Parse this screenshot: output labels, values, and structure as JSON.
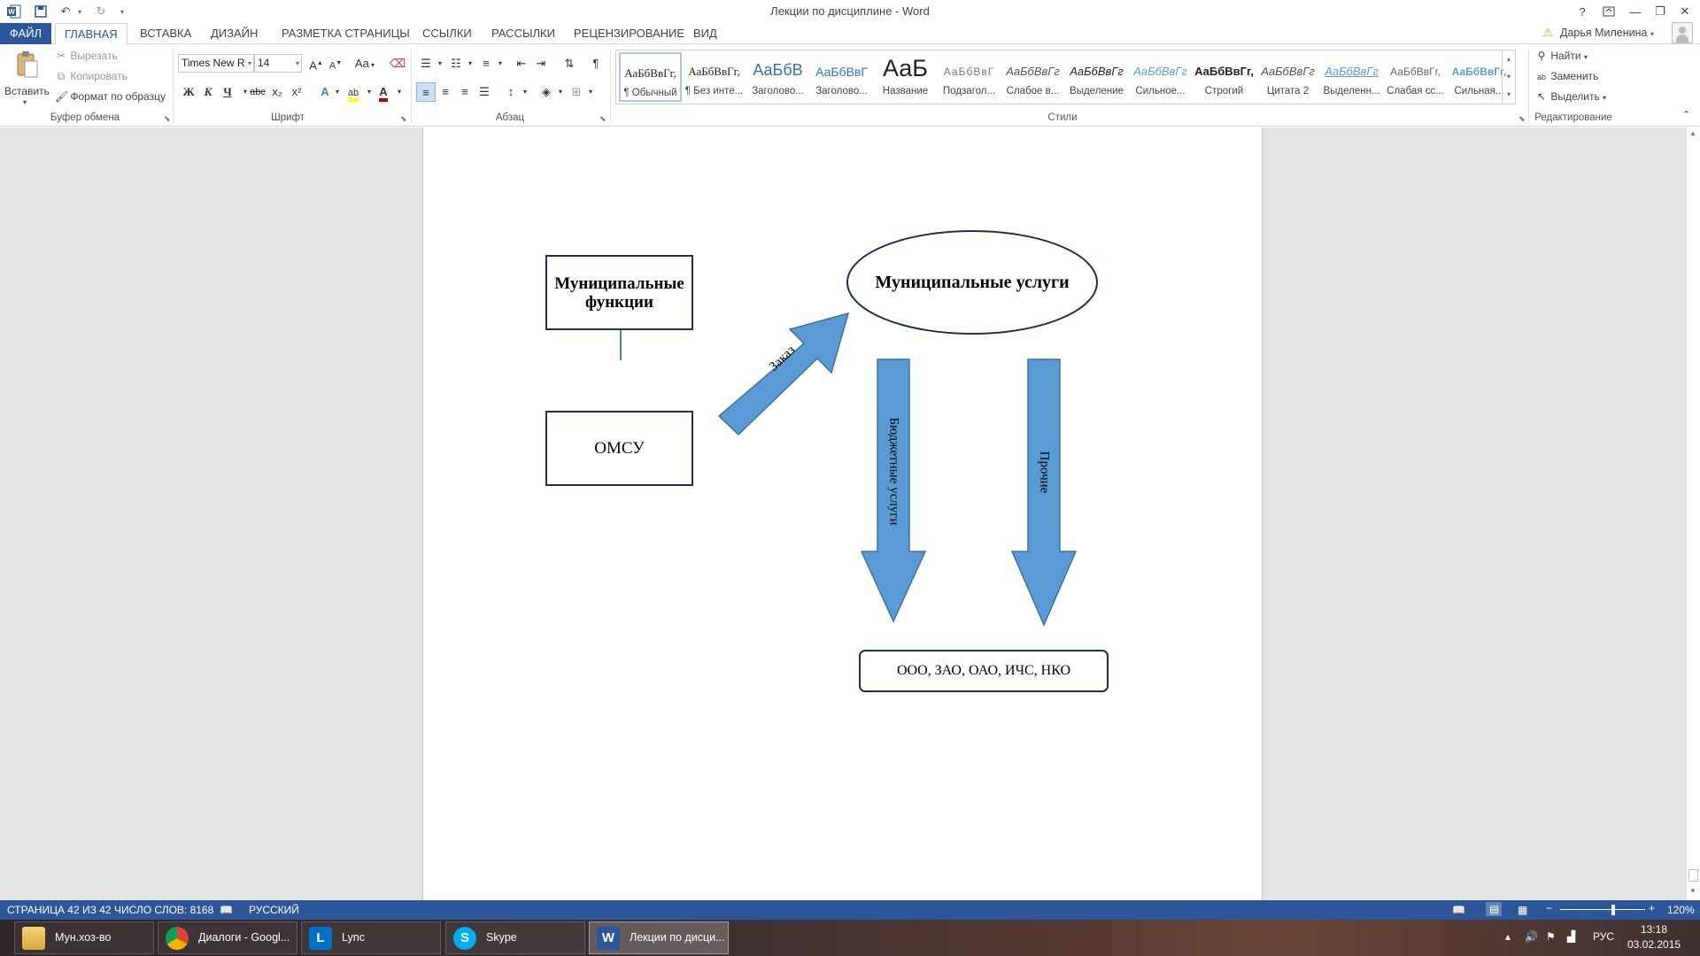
{
  "titlebar": {
    "title": "Лекции по дисциплине - Word",
    "help": "?",
    "minimize": "—",
    "restore": "❐",
    "close": "✕"
  },
  "tabs": [
    {
      "label": "ФАЙЛ"
    },
    {
      "label": "ГЛАВНАЯ"
    },
    {
      "label": "ВСТАВКА"
    },
    {
      "label": "ДИЗАЙН"
    },
    {
      "label": "РАЗМЕТКА СТРАНИЦЫ"
    },
    {
      "label": "ССЫЛКИ"
    },
    {
      "label": "РАССЫЛКИ"
    },
    {
      "label": "РЕЦЕНЗИРОВАНИЕ"
    },
    {
      "label": "ВИД"
    }
  ],
  "user": {
    "name": "Дарья Миленина"
  },
  "clipboard": {
    "paste": "Вставить",
    "cut": "Вырезать",
    "copy": "Копировать",
    "format_painter": "Формат по образцу",
    "group_label": "Буфер обмена"
  },
  "font": {
    "family": "Times New R",
    "size": "14",
    "grow": "A",
    "shrink": "A",
    "case": "Aa",
    "bold": "Ж",
    "italic": "К",
    "underline": "Ч",
    "strike": "abc",
    "subscript": "x₂",
    "superscript": "x²",
    "group_label": "Шрифт"
  },
  "paragraph": {
    "pilcrow": "¶",
    "group_label": "Абзац"
  },
  "styles": {
    "group_label": "Стили",
    "items": [
      {
        "sample": "АаБбВвГг,",
        "name": "¶ Обычный"
      },
      {
        "sample": "АаБбВвГг,",
        "name": "¶ Без инте..."
      },
      {
        "sample": "АаБбВ",
        "name": "Заголово..."
      },
      {
        "sample": "АаБбВвГ",
        "name": "Заголово..."
      },
      {
        "sample": "АаБ",
        "name": "Название"
      },
      {
        "sample": "АаБбВвГ",
        "name": "Подзагол..."
      },
      {
        "sample": "АаБбВвГг",
        "name": "Слабое в..."
      },
      {
        "sample": "АаБбВвГг",
        "name": "Выделение"
      },
      {
        "sample": "АаБбВвГг",
        "name": "Сильное..."
      },
      {
        "sample": "АаБбВвГг,",
        "name": "Строгий"
      },
      {
        "sample": "АаБбВвГг",
        "name": "Цитата 2"
      },
      {
        "sample": "АаБбВвГг",
        "name": "Выделенн..."
      },
      {
        "sample": "АаБбВвГг,",
        "name": "Слабая сс..."
      },
      {
        "sample": "АаБбВвГг,",
        "name": "Сильная..."
      }
    ]
  },
  "editing": {
    "find": "Найти",
    "replace": "Заменить",
    "select": "Выделить",
    "group_label": "Редактирование"
  },
  "diagram": {
    "functions_box": "Муниципальные функции",
    "services_ellipse": "Муниципальные услуги",
    "omsu_box": "ОМСУ",
    "order_arrow": "Заказ",
    "budget_arrow": "Бюджетные услуги",
    "other_arrow": "Прочие",
    "orgs_box": "ООО, ЗАО, ОАО, ИЧС, НКО",
    "colors": {
      "arrow_fill": "#5b9bd5",
      "arrow_stroke": "#41719c",
      "box_border": "#1f2f4f"
    }
  },
  "statusbar": {
    "page": "СТРАНИЦА 42 ИЗ 42",
    "words": "ЧИСЛО СЛОВ: 8168",
    "language": "РУССКИЙ",
    "zoom": "120%",
    "zoom_percent": 120
  },
  "taskbar": {
    "items": [
      {
        "label": "Мун.хоз-во"
      },
      {
        "label": "Диалоги - Googl..."
      },
      {
        "label": "Lync"
      },
      {
        "label": "Skype"
      },
      {
        "label": "Лекции по дисци..."
      }
    ],
    "lang": "РУС",
    "time": "13:18",
    "date": "03.02.2015"
  }
}
